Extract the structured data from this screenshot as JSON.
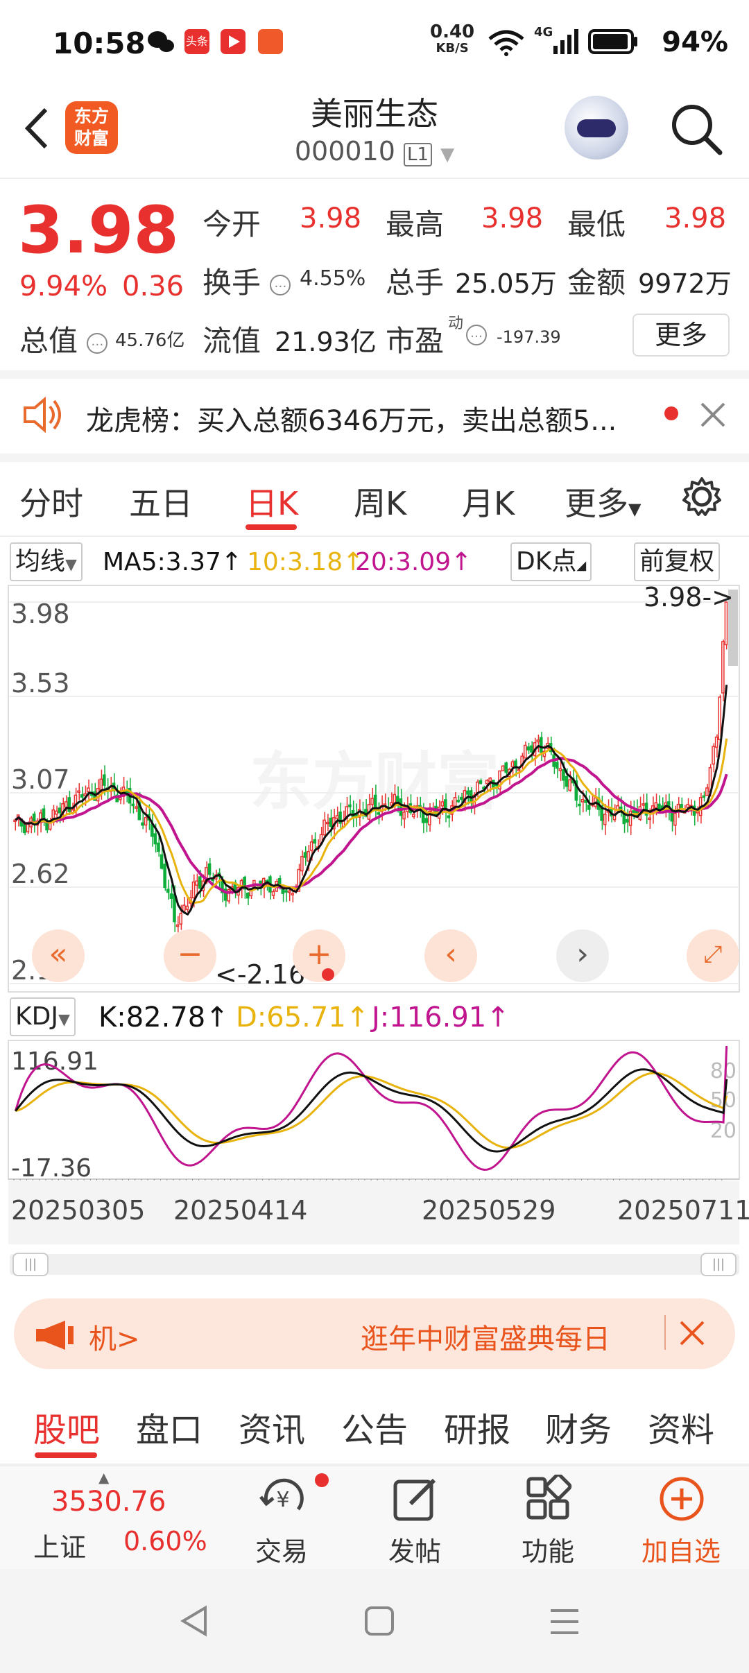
{
  "status": {
    "time": "10:58",
    "net_speed": "0.40",
    "net_unit": "KB/S",
    "net_type": "4G",
    "battery": "94%"
  },
  "header": {
    "logo_text_1": "东方",
    "logo_text_2": "财富",
    "title": "美丽生态",
    "code": "000010",
    "code_badge": "L1"
  },
  "quote": {
    "price": "3.98",
    "pct": "9.94%",
    "change": "0.36",
    "open_label": "今开",
    "open": "3.98",
    "high_label": "最高",
    "high": "3.98",
    "low_label": "最低",
    "low": "3.98",
    "turnover_label": "换手",
    "turnover": "4.55%",
    "volume_label": "总手",
    "volume": "25.05万",
    "amount_label": "金额",
    "amount": "9972万",
    "mcap_label": "总值",
    "mcap": "45.76亿",
    "float_label": "流值",
    "float_cap": "21.93亿",
    "pe_label": "市盈",
    "pe_sup": "动",
    "pe": "-197.39",
    "more": "更多"
  },
  "notice": {
    "label": "龙虎榜：",
    "text": "买入总额6346万元，卖出总额5..."
  },
  "tabs": [
    "分时",
    "五日",
    "日K",
    "周K",
    "月K",
    "更多"
  ],
  "active_tab": "日K",
  "chart_controls": {
    "ma_select": "均线",
    "ma5": "MA5:3.37",
    "ma10": "10:3.18",
    "ma20": "20:3.09",
    "dk": "DK点",
    "adjust": "前复权"
  },
  "kdj": {
    "select": "KDJ",
    "k": "K:82.78",
    "d": "D:65.71",
    "j": "J:116.91"
  },
  "chart_data": {
    "type": "candlestick",
    "price_axis": {
      "ticks": [
        "3.98",
        "3.53",
        "3.07",
        "2.62",
        "2.16"
      ],
      "range": [
        2.16,
        3.98
      ]
    },
    "annotations": {
      "high_marker": "3.98->",
      "low_marker": "<-2.16"
    },
    "x_ticks": [
      "20250305",
      "20250414",
      "20250529",
      "20250711"
    ],
    "kdj_axis": {
      "ticks": [
        "116.91",
        "-17.36"
      ],
      "right_ticks": [
        "80",
        "50",
        "20"
      ]
    },
    "colors": {
      "up": "#e8312f",
      "down": "#0fae3b",
      "ma5": "#111111",
      "ma10": "#e9b30d",
      "ma20": "#c0158f"
    },
    "watermark": "东方财富"
  },
  "banner": {
    "left_text": "机>",
    "right_text": "逛年中财富盛典每日"
  },
  "bottom_tabs": [
    "股吧",
    "盘口",
    "资讯",
    "公告",
    "研报",
    "财务",
    "资料"
  ],
  "active_bottom_tab": "股吧",
  "toolbar": {
    "index_value": "3530.76",
    "index_name": "上证",
    "index_pct": "0.60%",
    "trade": "交易",
    "post": "发帖",
    "func": "功能",
    "add": "加自选"
  }
}
